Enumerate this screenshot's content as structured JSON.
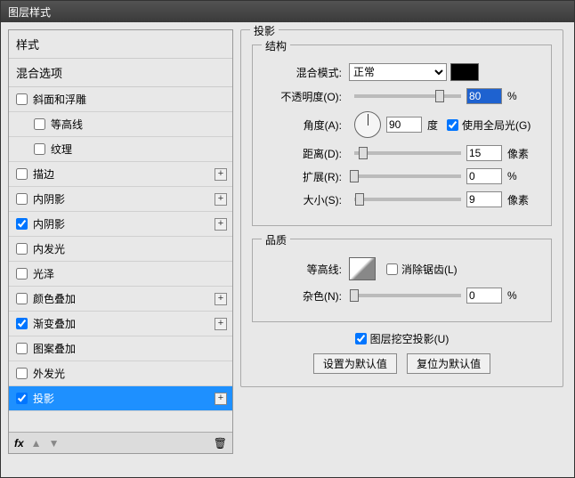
{
  "title": "图层样式",
  "left": {
    "stylesHeader": "样式",
    "blendHeader": "混合选项",
    "items": [
      {
        "label": "斜面和浮雕",
        "checked": false,
        "plus": false,
        "indent": false
      },
      {
        "label": "等高线",
        "checked": false,
        "plus": false,
        "indent": true
      },
      {
        "label": "纹理",
        "checked": false,
        "plus": false,
        "indent": true
      },
      {
        "label": "描边",
        "checked": false,
        "plus": true,
        "indent": false
      },
      {
        "label": "内阴影",
        "checked": false,
        "plus": true,
        "indent": false
      },
      {
        "label": "内阴影",
        "checked": true,
        "plus": true,
        "indent": false
      },
      {
        "label": "内发光",
        "checked": false,
        "plus": false,
        "indent": false
      },
      {
        "label": "光泽",
        "checked": false,
        "plus": false,
        "indent": false
      },
      {
        "label": "颜色叠加",
        "checked": false,
        "plus": true,
        "indent": false
      },
      {
        "label": "渐变叠加",
        "checked": true,
        "plus": true,
        "indent": false
      },
      {
        "label": "图案叠加",
        "checked": false,
        "plus": false,
        "indent": false
      },
      {
        "label": "外发光",
        "checked": false,
        "plus": false,
        "indent": false
      },
      {
        "label": "投影",
        "checked": true,
        "plus": true,
        "indent": false,
        "selected": true
      }
    ],
    "fx": "fx"
  },
  "right": {
    "panelTitle": "投影",
    "structure": {
      "title": "结构",
      "blendModeLabel": "混合模式:",
      "blendModeValue": "正常",
      "opacityLabel": "不透明度(O):",
      "opacityValue": "80",
      "opacityUnit": "%",
      "angleLabel": "角度(A):",
      "angleValue": "90",
      "angleUnit": "度",
      "globalLightLabel": "使用全局光(G)",
      "globalLightChecked": true,
      "distanceLabel": "距离(D):",
      "distanceValue": "15",
      "distanceUnit": "像素",
      "spreadLabel": "扩展(R):",
      "spreadValue": "0",
      "spreadUnit": "%",
      "sizeLabel": "大小(S):",
      "sizeValue": "9",
      "sizeUnit": "像素"
    },
    "quality": {
      "title": "品质",
      "contourLabel": "等高线:",
      "antiAliasLabel": "消除锯齿(L)",
      "antiAliasChecked": false,
      "noiseLabel": "杂色(N):",
      "noiseValue": "0",
      "noiseUnit": "%"
    },
    "knockoutLabel": "图层挖空投影(U)",
    "knockoutChecked": true,
    "defaultBtn": "设置为默认值",
    "resetBtn": "复位为默认值"
  }
}
